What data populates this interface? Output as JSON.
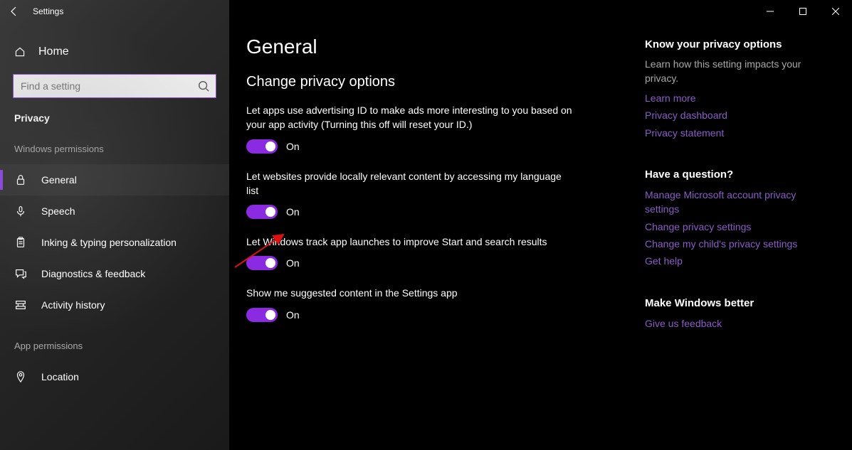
{
  "app": {
    "title": "Settings"
  },
  "sidebar": {
    "home": "Home",
    "search_placeholder": "Find a setting",
    "section": "Privacy",
    "group1": "Windows permissions",
    "items1": [
      {
        "label": "General"
      },
      {
        "label": "Speech"
      },
      {
        "label": "Inking & typing personalization"
      },
      {
        "label": "Diagnostics & feedback"
      },
      {
        "label": "Activity history"
      }
    ],
    "group2": "App permissions",
    "items2": [
      {
        "label": "Location"
      }
    ]
  },
  "main": {
    "title": "General",
    "subheading": "Change privacy options",
    "settings": [
      {
        "text": "Let apps use advertising ID to make ads more interesting to you based on your app activity (Turning this off will reset your ID.)",
        "state": "On"
      },
      {
        "text": "Let websites provide locally relevant content by accessing my language list",
        "state": "On"
      },
      {
        "text": "Let Windows track app launches to improve Start and search results",
        "state": "On"
      },
      {
        "text": "Show me suggested content in the Settings app",
        "state": "On"
      }
    ]
  },
  "aside": {
    "g1_heading": "Know your privacy options",
    "g1_text": "Learn how this setting impacts your privacy.",
    "g1_links": [
      "Learn more",
      "Privacy dashboard",
      "Privacy statement"
    ],
    "g2_heading": "Have a question?",
    "g2_links": [
      "Manage Microsoft account privacy settings",
      "Change privacy settings",
      "Change my child's privacy settings",
      "Get help"
    ],
    "g3_heading": "Make Windows better",
    "g3_links": [
      "Give us feedback"
    ]
  }
}
